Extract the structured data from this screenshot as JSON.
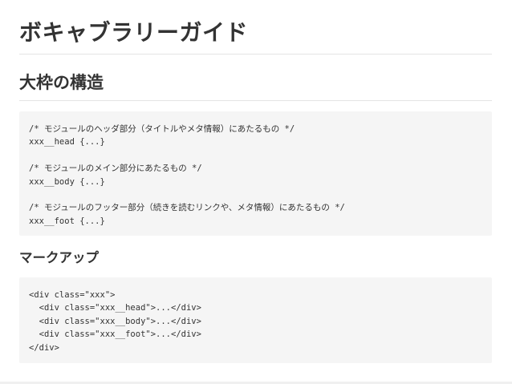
{
  "page": {
    "title": "ボキャブラリーガイド",
    "section_title": "大枠の構造",
    "subsection_title": "マークアップ"
  },
  "code_block_structure": {
    "lines": [
      "/* モジュールのヘッダ部分（タイトルやメタ情報）にあたるもの */",
      "xxx__head {...}",
      "",
      "/* モジュールのメイン部分にあたるもの */",
      "xxx__body {...}",
      "",
      "/* モジュールのフッター部分（続きを読むリンクや、メタ情報）にあたるもの */",
      "xxx__foot {...}"
    ]
  },
  "code_block_markup": {
    "lines": [
      "<div class=\"xxx\">",
      "  <div class=\"xxx__head\">...</div>",
      "  <div class=\"xxx__body\">...</div>",
      "  <div class=\"xxx__foot\">...</div>",
      "</div>"
    ]
  },
  "colors": {
    "text": "#333333",
    "code_background": "#f5f5f5",
    "divider": "#e4e4e4",
    "page_background": "#ffffff"
  }
}
